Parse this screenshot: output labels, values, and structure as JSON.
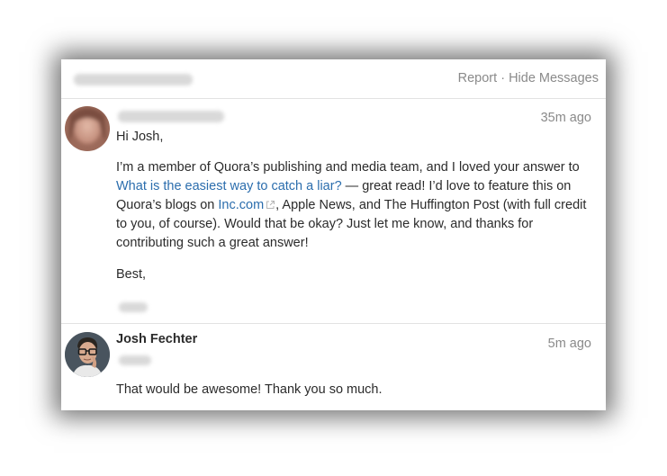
{
  "header": {
    "actions": {
      "report": "Report",
      "separator": " · ",
      "hide": "Hide Messages"
    }
  },
  "messages": [
    {
      "time": "35m ago",
      "greeting": "Hi Josh,",
      "para_pre": "I’m a member of Quora’s publishing and media team, and I loved your answer to ",
      "question_link": "What is the easiest way to catch a liar?",
      "para_mid": " — great read! I’d love to feature this on Quora’s blogs on ",
      "site_link": "Inc.com",
      "para_post": ", Apple News, and The Huffington Post (with full credit to you, of course). Would that be okay? Just let me know, and thanks for contributing such a great answer!",
      "signoff": "Best,"
    },
    {
      "author": "Josh Fechter",
      "time": "5m ago",
      "body": "That would be awesome! Thank you so much."
    }
  ],
  "icons": {
    "external_link": "external-link-icon"
  },
  "colors": {
    "link": "#2b6dad",
    "muted": "#8a8a8a",
    "text": "#2b2b2b"
  }
}
